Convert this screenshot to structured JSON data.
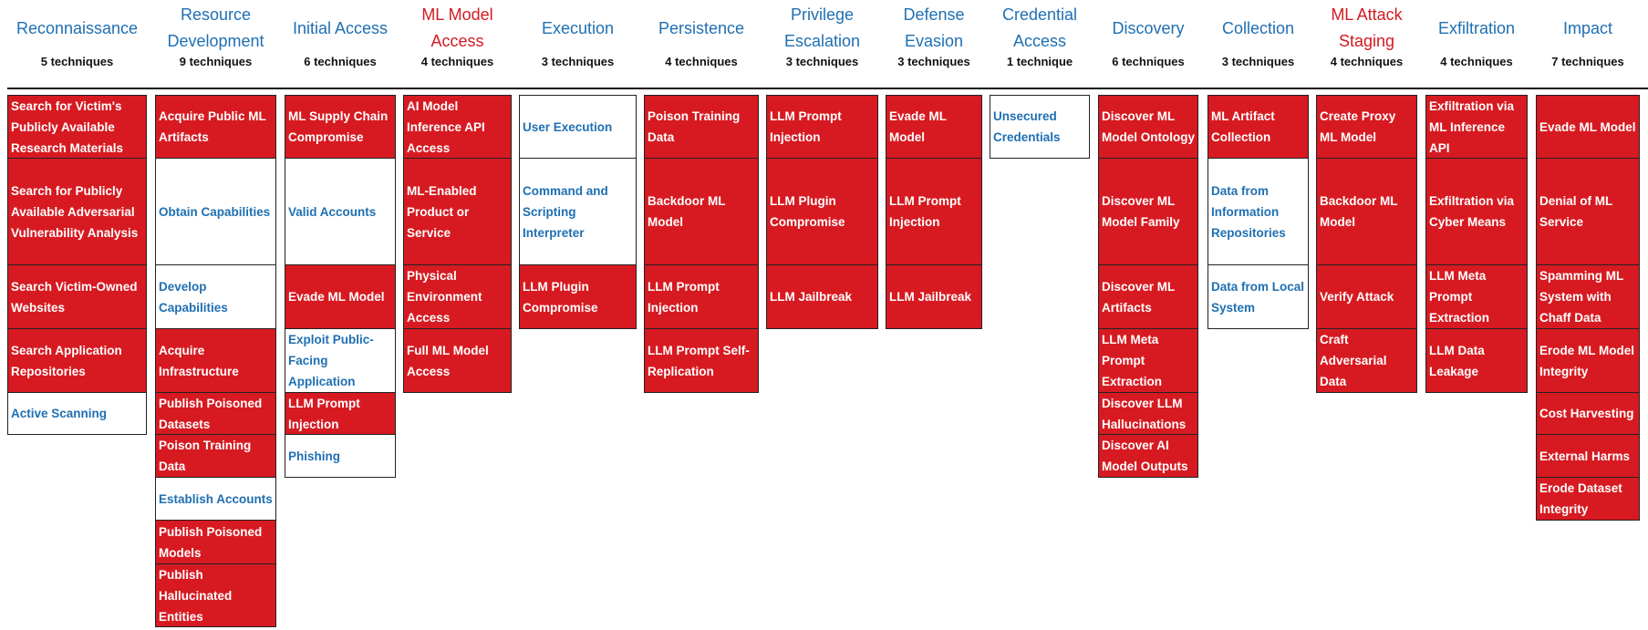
{
  "colors": {
    "technique_fill": "#d71a21",
    "link_text": "#1f6fb2",
    "ml_tactic_title": "#d21a22",
    "tactic_title": "#1f6fb2"
  },
  "tactics": [
    {
      "title": "Reconnaissance",
      "ml": false,
      "count": "5 techniques",
      "techniques": [
        {
          "name": "Search for Victim's Publicly Available Research Materials",
          "style": "red"
        },
        {
          "name": "Search for Publicly Available Adversarial Vulnerability Analysis",
          "style": "red"
        },
        {
          "name": "Search Victim-Owned Websites",
          "style": "red"
        },
        {
          "name": "Search Application Repositories",
          "style": "red"
        },
        {
          "name": "Active Scanning",
          "style": "white"
        }
      ]
    },
    {
      "title": "Resource Development",
      "ml": false,
      "count": "9 techniques",
      "techniques": [
        {
          "name": "Acquire Public ML Artifacts",
          "style": "red"
        },
        {
          "name": "Obtain Capabilities",
          "style": "white"
        },
        {
          "name": "Develop Capabilities",
          "style": "white"
        },
        {
          "name": "Acquire Infrastructure",
          "style": "red"
        },
        {
          "name": "Publish Poisoned Datasets",
          "style": "red"
        },
        {
          "name": "Poison Training Data",
          "style": "red"
        },
        {
          "name": "Establish Accounts",
          "style": "white"
        },
        {
          "name": "Publish Poisoned Models",
          "style": "red"
        },
        {
          "name": "Publish Hallucinated Entities",
          "style": "red"
        }
      ]
    },
    {
      "title": "Initial Access",
      "ml": false,
      "count": "6 techniques",
      "techniques": [
        {
          "name": "ML Supply Chain Compromise",
          "style": "red"
        },
        {
          "name": "Valid Accounts",
          "style": "white"
        },
        {
          "name": "Evade ML Model",
          "style": "red"
        },
        {
          "name": "Exploit Public-Facing Application",
          "style": "white"
        },
        {
          "name": "LLM Prompt Injection",
          "style": "red"
        },
        {
          "name": "Phishing",
          "style": "white"
        }
      ]
    },
    {
      "title": "ML Model Access",
      "ml": true,
      "count": "4 techniques",
      "techniques": [
        {
          "name": "AI Model Inference API Access",
          "style": "red"
        },
        {
          "name": "ML-Enabled Product or Service",
          "style": "red"
        },
        {
          "name": "Physical Environment Access",
          "style": "red"
        },
        {
          "name": "Full ML Model Access",
          "style": "red"
        }
      ]
    },
    {
      "title": "Execution",
      "ml": false,
      "count": "3 techniques",
      "techniques": [
        {
          "name": "User Execution",
          "style": "white"
        },
        {
          "name": "Command and Scripting Interpreter",
          "style": "white"
        },
        {
          "name": "LLM Plugin Compromise",
          "style": "red"
        }
      ]
    },
    {
      "title": "Persistence",
      "ml": false,
      "count": "4 techniques",
      "techniques": [
        {
          "name": "Poison Training Data",
          "style": "red"
        },
        {
          "name": "Backdoor ML Model",
          "style": "red"
        },
        {
          "name": "LLM Prompt Injection",
          "style": "red"
        },
        {
          "name": "LLM Prompt Self-Replication",
          "style": "red"
        }
      ]
    },
    {
      "title": "Privilege Escalation",
      "ml": false,
      "count": "3 techniques",
      "techniques": [
        {
          "name": "LLM Prompt Injection",
          "style": "red"
        },
        {
          "name": "LLM Plugin Compromise",
          "style": "red"
        },
        {
          "name": "LLM Jailbreak",
          "style": "red"
        }
      ]
    },
    {
      "title": "Defense Evasion",
      "ml": false,
      "count": "3 techniques",
      "techniques": [
        {
          "name": "Evade ML Model",
          "style": "red"
        },
        {
          "name": "LLM Prompt Injection",
          "style": "red"
        },
        {
          "name": "LLM Jailbreak",
          "style": "red"
        }
      ]
    },
    {
      "title": "Credential Access",
      "ml": false,
      "count": "1 technique",
      "techniques": [
        {
          "name": "Unsecured Credentials",
          "style": "white"
        }
      ]
    },
    {
      "title": "Discovery",
      "ml": false,
      "count": "6 techniques",
      "techniques": [
        {
          "name": "Discover ML Model Ontology",
          "style": "red"
        },
        {
          "name": "Discover ML Model Family",
          "style": "red"
        },
        {
          "name": "Discover ML Artifacts",
          "style": "red"
        },
        {
          "name": "LLM Meta Prompt Extraction",
          "style": "red"
        },
        {
          "name": "Discover LLM Hallucinations",
          "style": "red"
        },
        {
          "name": "Discover AI Model Outputs",
          "style": "red"
        }
      ]
    },
    {
      "title": "Collection",
      "ml": false,
      "count": "3 techniques",
      "techniques": [
        {
          "name": "ML Artifact Collection",
          "style": "red"
        },
        {
          "name": "Data from Information Repositories",
          "style": "white"
        },
        {
          "name": "Data from Local System",
          "style": "white"
        }
      ]
    },
    {
      "title": "ML Attack Staging",
      "ml": true,
      "count": "4 techniques",
      "techniques": [
        {
          "name": "Create Proxy ML Model",
          "style": "red"
        },
        {
          "name": "Backdoor ML Model",
          "style": "red"
        },
        {
          "name": "Verify Attack",
          "style": "red"
        },
        {
          "name": "Craft Adversarial Data",
          "style": "red"
        }
      ]
    },
    {
      "title": "Exfiltration",
      "ml": false,
      "count": "4 techniques",
      "techniques": [
        {
          "name": "Exfiltration via ML Inference API",
          "style": "red"
        },
        {
          "name": "Exfiltration via Cyber Means",
          "style": "red"
        },
        {
          "name": "LLM Meta Prompt Extraction",
          "style": "red"
        },
        {
          "name": "LLM Data Leakage",
          "style": "red"
        }
      ]
    },
    {
      "title": "Impact",
      "ml": false,
      "count": "7 techniques",
      "techniques": [
        {
          "name": "Evade ML Model",
          "style": "red"
        },
        {
          "name": "Denial of ML Service",
          "style": "red"
        },
        {
          "name": "Spamming ML System with Chaff Data",
          "style": "red"
        },
        {
          "name": "Erode ML Model Integrity",
          "style": "red"
        },
        {
          "name": "Cost Harvesting",
          "style": "red"
        },
        {
          "name": "External Harms",
          "style": "red"
        },
        {
          "name": "Erode Dataset Integrity",
          "style": "red"
        }
      ]
    }
  ]
}
